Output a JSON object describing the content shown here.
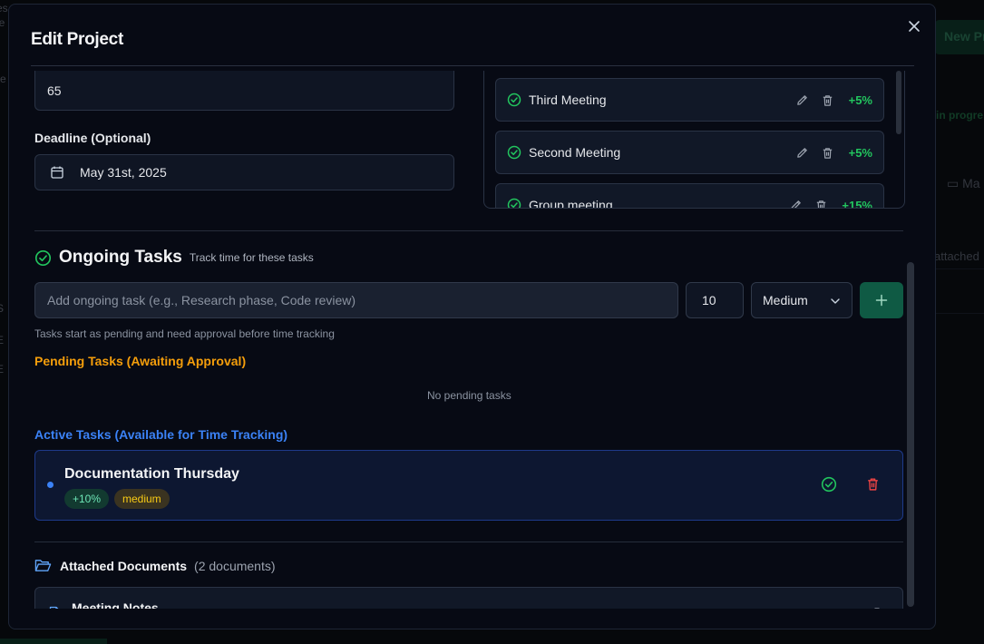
{
  "background": {
    "new_project_label": "New Pr",
    "status_badge": "in progre",
    "date_text": "Ma",
    "attached_text": "attached",
    "left_fragments": [
      "es",
      "le",
      "re",
      "S",
      "E",
      "E"
    ]
  },
  "modal": {
    "title": "Edit Project",
    "close_label": "×"
  },
  "progress_field": {
    "value": "65"
  },
  "deadline": {
    "label": "Deadline (Optional)",
    "value": "May 31st, 2025"
  },
  "milestones": [
    {
      "name": "Third Meeting",
      "percent": "+5%"
    },
    {
      "name": "Second Meeting",
      "percent": "+5%"
    },
    {
      "name": "Group meeting",
      "percent": "+15%"
    }
  ],
  "ongoing_tasks": {
    "title": "Ongoing Tasks",
    "subtitle": "Track time for these tasks",
    "input_placeholder": "Add ongoing task (e.g., Research phase, Code review)",
    "percent_value": "10",
    "priority_value": "Medium",
    "add_label": "+",
    "hint": "Tasks start as pending and need approval before time tracking",
    "pending_title": "Pending Tasks (Awaiting Approval)",
    "no_pending": "No pending tasks",
    "active_title": "Active Tasks (Available for Time Tracking)",
    "active_tasks": [
      {
        "name": "Documentation Thursday",
        "percent": "+10%",
        "priority": "medium"
      }
    ]
  },
  "documents": {
    "title": "Attached Documents",
    "count": "(2 documents)",
    "items": [
      {
        "name": "Meeting Notes"
      }
    ]
  },
  "colors": {
    "accent_green": "#22c55e",
    "pending_amber": "#f59e0b",
    "active_blue": "#3b82f6",
    "danger_red": "#ef4444",
    "modal_bg": "#070a14"
  },
  "icons": {
    "close": "close-icon",
    "calendar": "calendar-icon",
    "check_circle": "check-circle-icon",
    "edit": "pencil-icon",
    "trash": "trash-icon",
    "chevron_down": "chevron-down-icon",
    "plus": "plus-icon",
    "folder": "folder-open-icon",
    "document": "file-icon",
    "view": "eye-icon"
  }
}
